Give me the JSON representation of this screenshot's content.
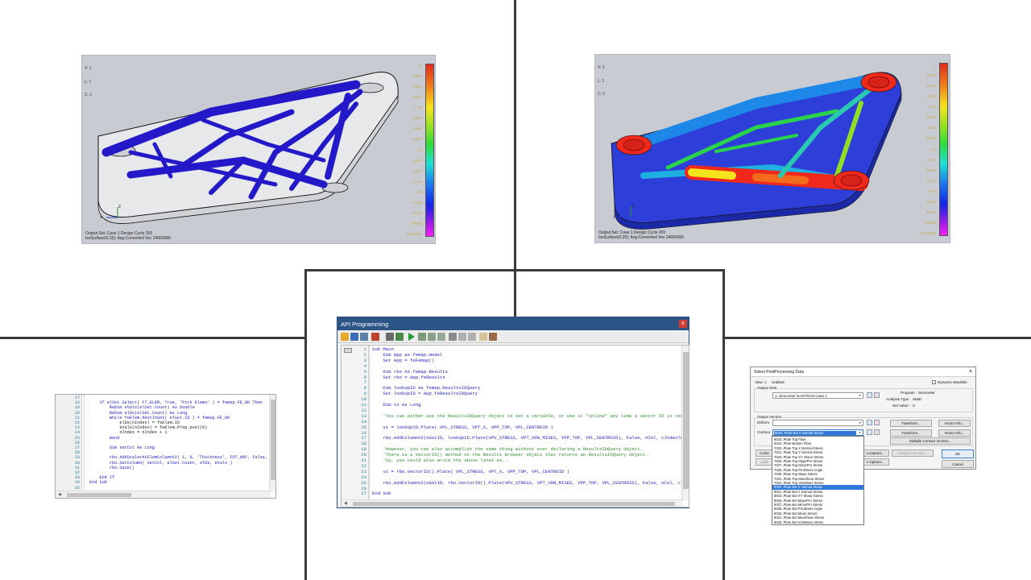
{
  "viewport_left": {
    "corner_lines": [
      "V: 1",
      "L: 1",
      "C: 1"
    ],
    "footer_line1": "Output Set: Case 1 Design Cycle 200",
    "footer_line2": "IsoSurface(0.15): Avg-Converted Vec 24000000",
    "legend": [
      "1.",
      "0.937",
      "0.875",
      "0.812",
      "0.75",
      "0.687",
      "0.625",
      "0.562",
      "0.5",
      "0.437",
      "0.375",
      "0.312",
      "0.25",
      "0.188",
      "0.125",
      "0.0625",
      "0.000001"
    ]
  },
  "viewport_right": {
    "corner_lines": [
      "V: 1",
      "L: 1",
      "C: 1"
    ],
    "footer_line1": "Output Set: Case 1 Design Cycle 200",
    "footer_line2": "IsoSurface(0.25): Avg-Converted Vec 24000000",
    "legend": [
      "1.",
      "0.937",
      "0.875",
      "0.812",
      "0.75",
      "0.687",
      "0.625",
      "0.562",
      "0.5",
      "0.437",
      "0.375",
      "0.312",
      "0.25",
      "0.188",
      "0.125",
      "0.0625",
      "0.000001"
    ]
  },
  "api_window": {
    "title": "API Programming",
    "close": "x",
    "line_numbers": [
      "1",
      "2",
      "3",
      "4",
      "5",
      "6",
      "7",
      "8",
      "9",
      "10",
      "11",
      "12",
      "13",
      "14",
      "15",
      "16",
      "17",
      "18",
      "19",
      "20",
      "21",
      "22",
      "23",
      "24",
      "25",
      "26",
      "27"
    ],
    "lines": [
      "Sub Main",
      "    Dim App as femap.model",
      "    Set App = feFemap()",
      "",
      "    Dim rbo As femap.Results",
      "    Set rbo = App.feResults",
      "",
      "    Dim lookUpID As femap.ResultsIDQuery",
      "    Set lookUpID = App.feResultsIDQuery",
      "",
      "    Dim v1 As Long",
      "",
      "    'You can either use the ResultsIDQuery object to set a variable, or use it \"inline\" any time a vector ID is required.  Like these examples...",
      "",
      "    v1 = lookUpID.Plate( VPL_STRESS, VPT_X, VPP_TOP, VPL_CENTROID )",
      "",
      "    rbo.AddColumnV2(oSetID, lookUpID.Plate(VPV_STRESS, VPT_VON_MISES, VPP_TOP, VPL_CENTROID), False, nCol, cIndexTop)",
      "",
      "    'However, you can also accomplish the same thing without ever declaring a ResultsIDQuery object.",
      "    'There is a VectorID() method on the Results Browser object that returns an ResultsIDQuery object.",
      "    'So, you could also write the above lines as...",
      "",
      "    v1 = rbo.VectorID().Plate( VPL_STRESS, VPT_X, VPP_TOP, VPL_CENTROID )",
      "",
      "    rbo.AddColumnV2(oSetID, rbo.VectorID().Plate(VPV_STRESS, VPT_VON_MISES, VPP_TOP, VPL_CENTROID), False, nCol, cIndexTop)",
      "",
      "End Sub"
    ],
    "line_kinds": [
      "kw",
      "mix",
      "mix",
      "",
      "mix",
      "mix",
      "",
      "mix",
      "mix",
      "",
      "kw",
      "",
      "cmt",
      "",
      "mix",
      "",
      "mix",
      "",
      "cmt",
      "cmt",
      "cmt",
      "",
      "mix",
      "",
      "mix",
      "",
      "kw"
    ]
  },
  "left_editor": {
    "line_numbers": [
      "17",
      "18",
      "19",
      "20",
      "21",
      "22",
      "23",
      "24",
      "25",
      "26",
      "27",
      "28",
      "29",
      "30",
      "31",
      "32",
      "33",
      "34",
      "35"
    ],
    "lines": [
      "",
      "    If elSet.Select( FT_ELEM, True, 'Pick Elems' ) = femap.FE_OK Then",
      "        ReDim eVals(elSet.Count) As Double",
      "        ReDim elDs(elSet.Count) As Long",
      "        While feElem.NextInSet( elSet.ID ) = femap.FE_OK",
      "            elDs(nIndex) = feElem.ID",
      "            eVals(nIndex) = feElem.Prop.pval(0)",
      "            nIndex = nIndex + 1",
      "        Wend",
      "",
      "        Dim setCol As Long",
      "",
      "        rbo.AddScalarAtElemColumnV2( 1, 0, 'Thickness', FOT_ANY, False, setCol )",
      "        rbo.SetColumn( setCol, elSet.Count, elDs, eVals )",
      "        rbo.Save()",
      "",
      "    End If",
      "End Sub",
      ""
    ],
    "line_kinds": [
      "",
      "mix",
      "mix",
      "mix",
      "mix",
      "plain",
      "plain",
      "plain",
      "kw",
      "",
      "kw",
      "",
      "mix",
      "mix",
      "mix",
      "",
      "kw",
      "kw",
      ""
    ]
  },
  "dialog": {
    "title": "Select PostProcessing Data",
    "close": "×",
    "view_label": "View",
    "view_num": "1",
    "view_name": "Untitled",
    "dynamic_label": "Dynamic Max/Min",
    "output_sets_label": "Output Sets",
    "output_set_value": "1..Simcenter NASTRAN Case 1",
    "program_label": "Program :",
    "program_value": "Simcenter",
    "analysis_label": "Analysis Type :",
    "analysis_value": "Static",
    "setvalue_label": "Set Value :",
    "setvalue_value": "0.",
    "output_vectors_label": "Output Vectors",
    "deform_label": "Deform",
    "contour_label": "Contour",
    "contour_value": "9020..Plate Bot X Normal Stress",
    "transform1": "Transform...",
    "transform2": "Transform...",
    "vector_info1": "Vector Info...",
    "vector_info2": "Vector Info...",
    "multiple_contour": "Multiple Contour Vectors...",
    "cont_btn": "Conto",
    "locations_btn": "Locations...",
    "complex_btn": "Complex Results...",
    "limits_btn": "Limit",
    "more_options_btn": "e Options...",
    "ok": "OK",
    "cancel": "Cancel",
    "dropdown_items": [
      "6043..Plate Top Fiber",
      "6044..Plate Bottom Fiber",
      "7020..Plate Top X Normal Stress",
      "7021..Plate Top Y Normal Stress",
      "7023..Plate Top XY Shear Stress",
      "7026..Plate Top MajorPrn Stress",
      "7027..Plate Top MinorPrn Stress",
      "7028..Plate Top PrnStress Angle",
      "7030..Plate Top Mean Stress",
      "7031..Plate Top MaxShear Stress",
      "7033..Plate Top VonMises Stress",
      "9020..Plate Bot X Normal Stress",
      "9021..Plate Bot Y Normal Stress",
      "9023..Plate Bot XY Shear Stress",
      "9026..Plate Bot MajorPrn Stress",
      "9027..Plate Bot MinorPrn Stress",
      "9028..Plate Bot PrnStress Angle",
      "9030..Plate Bot Mean Stress",
      "9031..Plate Bot MaxShear Stress",
      "9033..Plate Bot VonMises Stress"
    ],
    "selected_index": 11
  }
}
